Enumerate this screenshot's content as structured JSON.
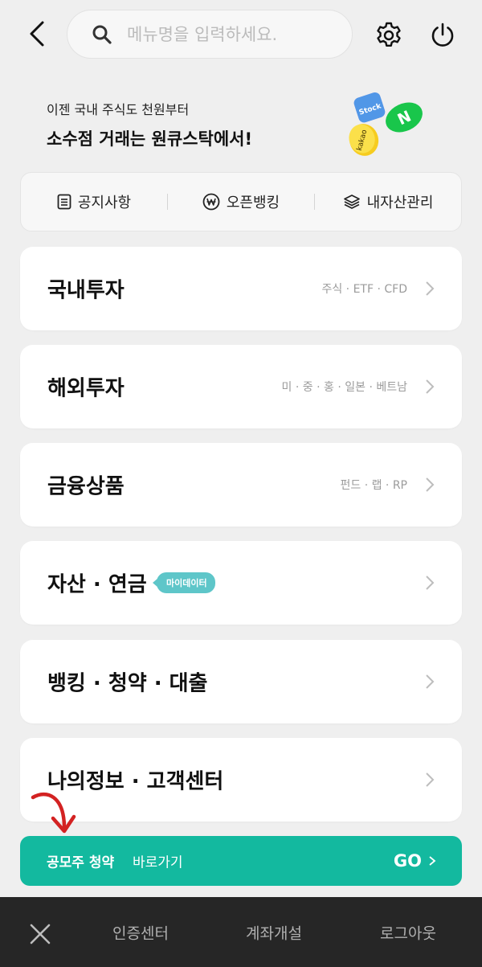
{
  "header": {
    "search_placeholder": "메뉴명을 입력하세요."
  },
  "promo": {
    "sub": "이젠 국내 주식도 천원부터",
    "main": "소수점 거래는 원큐스탁에서!",
    "coin_labels": [
      "Stock",
      "kakao",
      "N"
    ]
  },
  "quick_links": [
    "공지사항",
    "오픈뱅킹",
    "내자산관리"
  ],
  "menu": [
    {
      "title": "국내투자",
      "desc": "주식 · ETF · CFD"
    },
    {
      "title": "해외투자",
      "desc": "미 · 중 · 홍 · 일본 · 베트남"
    },
    {
      "title": "금융상품",
      "desc": "펀드 · 랩 · RP"
    },
    {
      "title": "자산 · 연금",
      "badge": "마이데이터"
    },
    {
      "title": "뱅킹 · 청약 · 대출"
    },
    {
      "title": "나의정보 · 고객센터"
    }
  ],
  "ipo": {
    "bold": "공모주 청약",
    "rest": "바로가기",
    "go": "GO"
  },
  "bottom_nav": [
    "인증센터",
    "계좌개설",
    "로그아웃"
  ],
  "colors": {
    "accent": "#13b99f",
    "badge": "#5ec6c9",
    "arrow": "#d32222"
  }
}
